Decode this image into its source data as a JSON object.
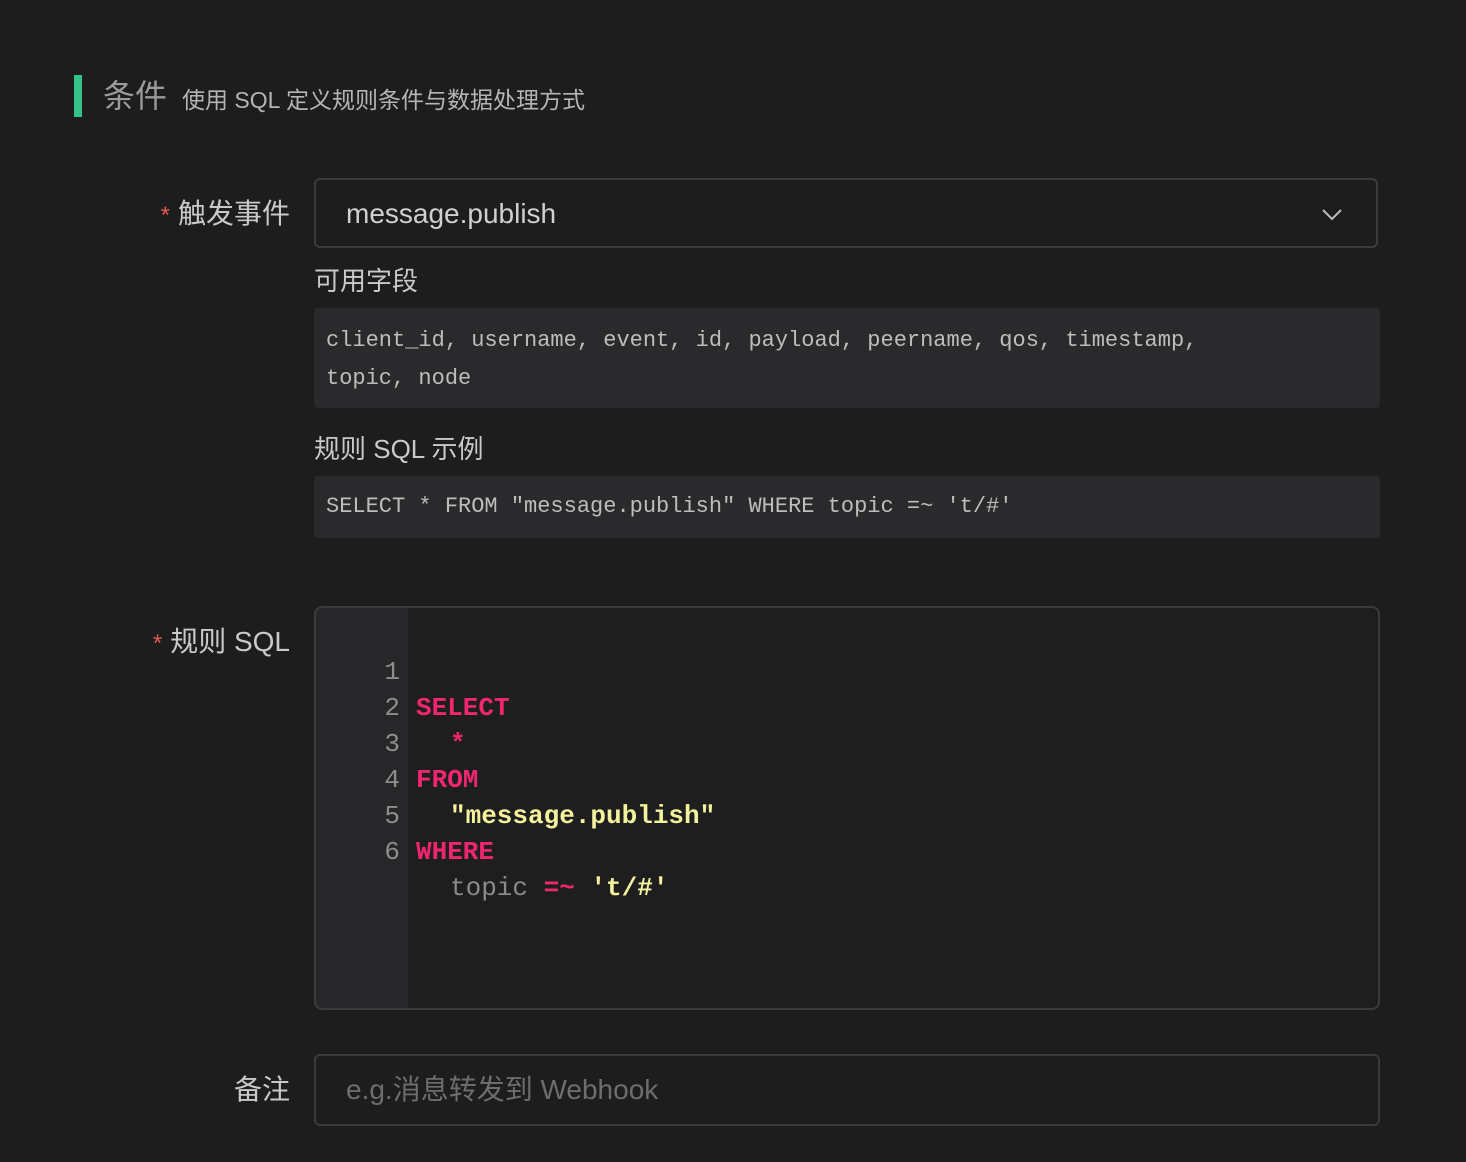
{
  "section": {
    "title": "条件",
    "description": "使用 SQL 定义规则条件与数据处理方式"
  },
  "trigger": {
    "label": "触发事件",
    "required_mark": "*",
    "selected": "message.publish",
    "icon": "chevron-down-icon"
  },
  "fields": {
    "label": "可用字段",
    "text": "client_id, username, event, id, payload, peername, qos, timestamp,\ntopic, node"
  },
  "example": {
    "label": "规则 SQL 示例",
    "sql": "SELECT * FROM \"message.publish\" WHERE topic =~ 't/#'"
  },
  "rule_sql": {
    "label": "规则 SQL",
    "required_mark": "*",
    "lines": [
      {
        "num": "1",
        "kw": "SELECT"
      },
      {
        "num": "2",
        "kw": "*"
      },
      {
        "num": "3",
        "kw": "FROM"
      },
      {
        "num": "4",
        "str": "\"message.publish\""
      },
      {
        "num": "5",
        "kw": "WHERE"
      },
      {
        "num": "6",
        "ident": "topic",
        "op": "=~",
        "str": "'t/#'"
      }
    ]
  },
  "note": {
    "label": "备注",
    "placeholder": "e.g.消息转发到 Webhook",
    "value": ""
  },
  "colors": {
    "accent": "#34c388",
    "required": "#e55a52",
    "keyword": "#f0266f",
    "string": "#f5f29e"
  }
}
